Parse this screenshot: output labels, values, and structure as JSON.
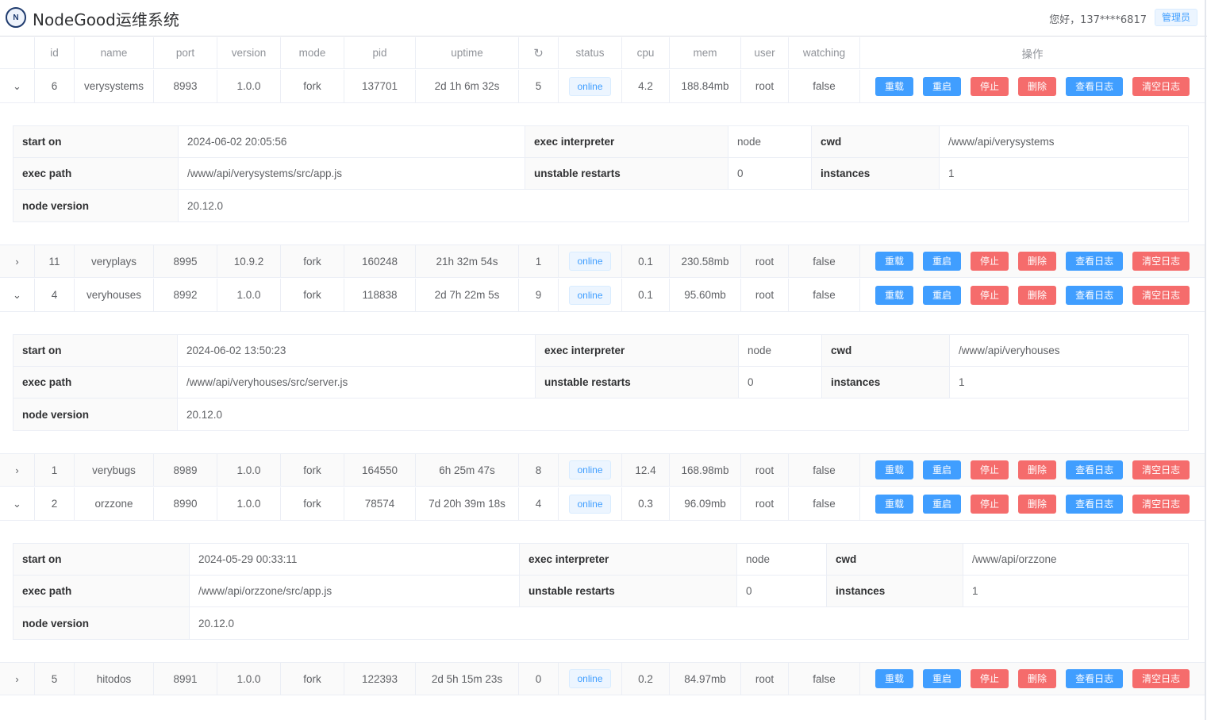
{
  "header": {
    "logo_text": "N",
    "title": "NodeGood运维系统",
    "greeting": "您好，137****6817",
    "role": "管理员"
  },
  "columns": {
    "id": "id",
    "name": "name",
    "port": "port",
    "version": "version",
    "mode": "mode",
    "pid": "pid",
    "uptime": "uptime",
    "restarts_icon": "↻",
    "status": "status",
    "cpu": "cpu",
    "mem": "mem",
    "user": "user",
    "watching": "watching",
    "ops": "操作"
  },
  "actions": {
    "reload": "重载",
    "restart": "重启",
    "stop": "停止",
    "delete": "删除",
    "view_log": "查看日志",
    "clear_log": "清空日志"
  },
  "detail_labels": {
    "start_on": "start on",
    "exec_interpreter": "exec interpreter",
    "cwd": "cwd",
    "exec_path": "exec path",
    "unstable_restarts": "unstable restarts",
    "instances": "instances",
    "node_version": "node version"
  },
  "processes": [
    {
      "arrow": "⌄",
      "id": "6",
      "name": "verysystems",
      "port": "8993",
      "version": "1.0.0",
      "mode": "fork",
      "pid": "137701",
      "uptime": "2d 1h 6m 32s",
      "restarts": "5",
      "status": "online",
      "cpu": "4.2",
      "mem": "188.84mb",
      "user": "root",
      "watching": "false"
    },
    {
      "arrow": "›",
      "id": "11",
      "name": "veryplays",
      "port": "8995",
      "version": "10.9.2",
      "mode": "fork",
      "pid": "160248",
      "uptime": "21h 32m 54s",
      "restarts": "1",
      "status": "online",
      "cpu": "0.1",
      "mem": "230.58mb",
      "user": "root",
      "watching": "false"
    },
    {
      "arrow": "⌄",
      "id": "4",
      "name": "veryhouses",
      "port": "8992",
      "version": "1.0.0",
      "mode": "fork",
      "pid": "118838",
      "uptime": "2d 7h 22m 5s",
      "restarts": "9",
      "status": "online",
      "cpu": "0.1",
      "mem": "95.60mb",
      "user": "root",
      "watching": "false"
    },
    {
      "arrow": "›",
      "id": "1",
      "name": "verybugs",
      "port": "8989",
      "version": "1.0.0",
      "mode": "fork",
      "pid": "164550",
      "uptime": "6h 25m 47s",
      "restarts": "8",
      "status": "online",
      "cpu": "12.4",
      "mem": "168.98mb",
      "user": "root",
      "watching": "false"
    },
    {
      "arrow": "⌄",
      "id": "2",
      "name": "orzzone",
      "port": "8990",
      "version": "1.0.0",
      "mode": "fork",
      "pid": "78574",
      "uptime": "7d 20h 39m 18s",
      "restarts": "4",
      "status": "online",
      "cpu": "0.3",
      "mem": "96.09mb",
      "user": "root",
      "watching": "false"
    },
    {
      "arrow": "›",
      "id": "5",
      "name": "hitodos",
      "port": "8991",
      "version": "1.0.0",
      "mode": "fork",
      "pid": "122393",
      "uptime": "2d 5h 15m 23s",
      "restarts": "0",
      "status": "online",
      "cpu": "0.2",
      "mem": "84.97mb",
      "user": "root",
      "watching": "false"
    }
  ],
  "details": [
    {
      "start_on": "2024-06-02 20:05:56",
      "exec_interpreter": "node",
      "cwd": "/www/api/verysystems",
      "exec_path": "/www/api/verysystems/src/app.js",
      "unstable_restarts": "0",
      "instances": "1",
      "node_version": "20.12.0"
    },
    {
      "start_on": "2024-06-02 13:50:23",
      "exec_interpreter": "node",
      "cwd": "/www/api/veryhouses",
      "exec_path": "/www/api/veryhouses/src/server.js",
      "unstable_restarts": "0",
      "instances": "1",
      "node_version": "20.12.0"
    },
    {
      "start_on": "2024-05-29 00:33:11",
      "exec_interpreter": "node",
      "cwd": "/www/api/orzzone",
      "exec_path": "/www/api/orzzone/src/app.js",
      "unstable_restarts": "0",
      "instances": "1",
      "node_version": "20.12.0"
    }
  ]
}
